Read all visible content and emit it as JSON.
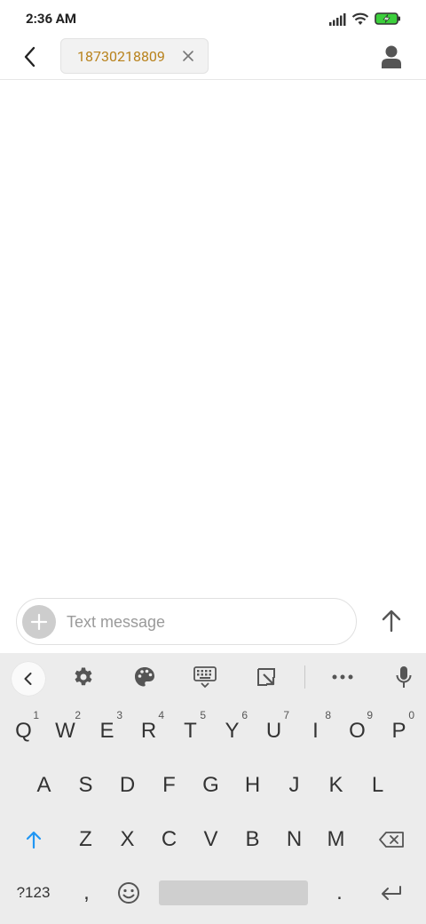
{
  "status_bar": {
    "time": "2:36 AM",
    "icons": [
      "signal-icon",
      "wifi-icon",
      "battery-charging-icon"
    ],
    "battery_color": "#3ccf3c"
  },
  "header": {
    "recipient": "18730218809",
    "recipient_color": "#b8821c",
    "icons": [
      "back-arrow-icon",
      "close-icon",
      "contact-icon"
    ]
  },
  "compose": {
    "placeholder": "Text message",
    "value": "",
    "icons": [
      "plus-icon",
      "send-arrow-icon"
    ]
  },
  "keyboard": {
    "toolbar_icons": [
      "chevron-left-icon",
      "gear-icon",
      "palette-icon",
      "keyboard-icon",
      "resize-icon",
      "more-icon",
      "mic-icon"
    ],
    "row1": [
      {
        "label": "Q",
        "hint": "1"
      },
      {
        "label": "W",
        "hint": "2"
      },
      {
        "label": "E",
        "hint": "3"
      },
      {
        "label": "R",
        "hint": "4"
      },
      {
        "label": "T",
        "hint": "5"
      },
      {
        "label": "Y",
        "hint": "6"
      },
      {
        "label": "U",
        "hint": "7"
      },
      {
        "label": "I",
        "hint": "8"
      },
      {
        "label": "O",
        "hint": "9"
      },
      {
        "label": "P",
        "hint": "0"
      }
    ],
    "row2": [
      "A",
      "S",
      "D",
      "F",
      "G",
      "H",
      "J",
      "K",
      "L"
    ],
    "row3": [
      "Z",
      "X",
      "C",
      "V",
      "B",
      "N",
      "M"
    ],
    "row4": {
      "symbols": "?123",
      "comma": ",",
      "period": "."
    },
    "accent_color": "#2196f3"
  }
}
